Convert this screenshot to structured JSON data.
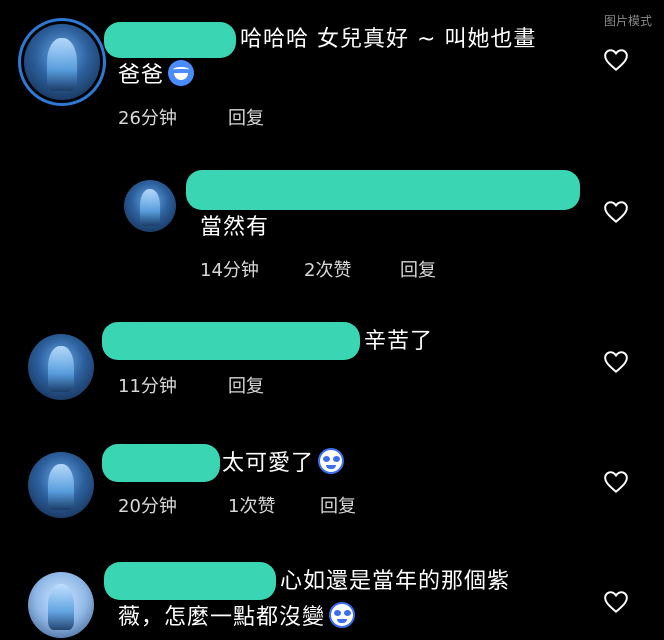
{
  "watermark": "图片模式",
  "colors": {
    "background": "#000000",
    "redaction": "#3ad6b3",
    "avatar_ring": "#2b7bd6"
  },
  "comments": [
    {
      "text_line1": "哈哈哈 女兒真好 ~ 叫她也畫",
      "text_line2": "爸爸",
      "emoji": "laughing-crying-emoji",
      "time": "26分钟",
      "reply": "回复"
    },
    {
      "text_line1": "當然有",
      "time": "14分钟",
      "likes": "2次赞",
      "reply": "回复"
    },
    {
      "text_line1": "辛苦了",
      "time": "11分钟",
      "reply": "回复"
    },
    {
      "text_line1": "太可愛了",
      "emoji": "heart-eyes-emoji",
      "time": "20分钟",
      "likes": "1次赞",
      "reply": "回复"
    },
    {
      "text_line1": "心如還是當年的那個紫",
      "text_line2": "薇，怎麼一點都沒變",
      "emoji": "heart-eyes-emoji"
    }
  ]
}
